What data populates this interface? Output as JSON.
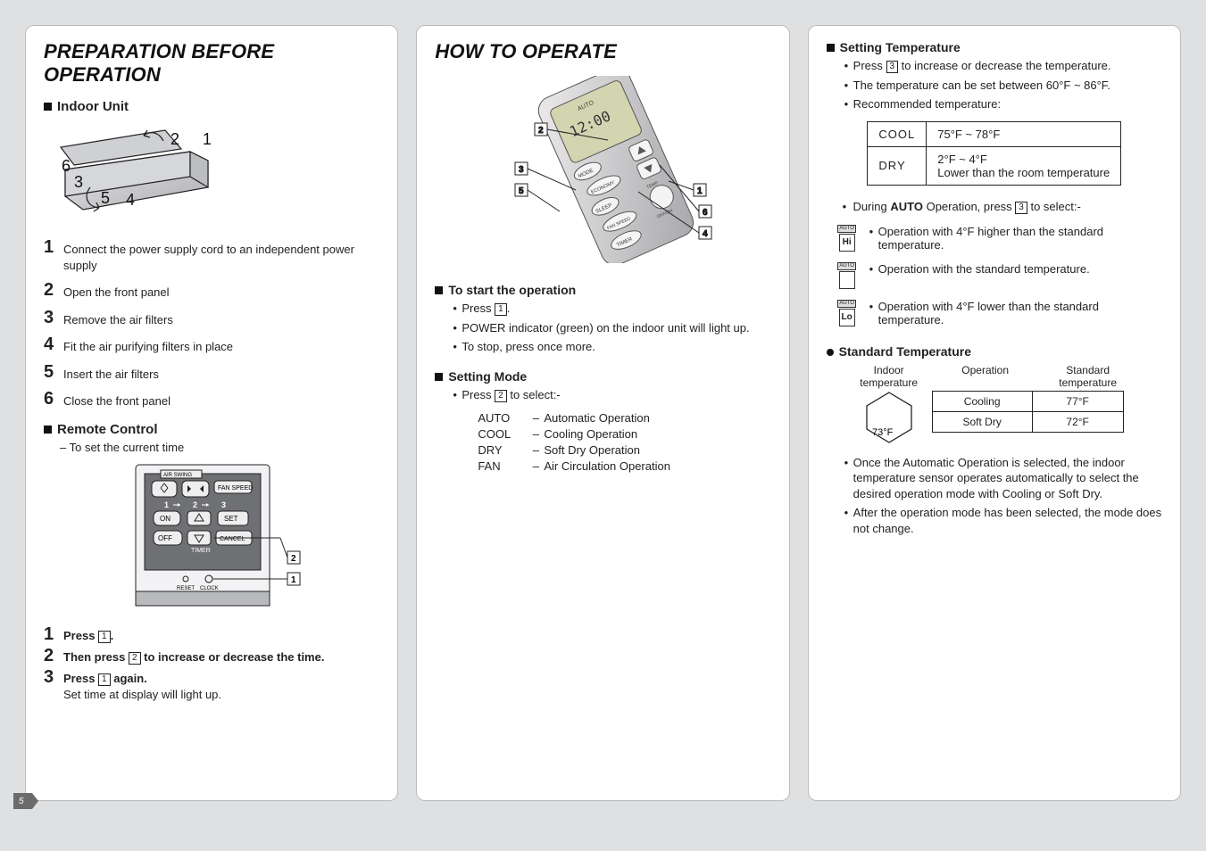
{
  "page_number": "5",
  "col1": {
    "title": "PREPARATION BEFORE OPERATION",
    "indoor_heading": "Indoor Unit",
    "indoor_labels": [
      "1",
      "2",
      "3",
      "4",
      "5",
      "6"
    ],
    "steps": [
      "Connect the power supply cord to an independent power supply",
      "Open the front panel",
      "Remove the air filters",
      "Fit the air purifying filters in place",
      "Insert the air filters",
      "Close the front panel"
    ],
    "remote_heading": "Remote Control",
    "remote_note": "– To set the current time",
    "remote_labels": {
      "air_swing": "AIR SWING",
      "fan_speed": "FAN SPEED",
      "on": "ON",
      "set": "SET",
      "off": "OFF",
      "cancel": "CANCEL",
      "timer": "TIMER",
      "reset": "RESET",
      "clock": "CLOCK",
      "n1": "1",
      "n2": "2",
      "n3": "3",
      "callout1": "1",
      "callout2": "2"
    },
    "remote_steps": {
      "s1": "Press ",
      "s1b": ".",
      "s2a": "Then press ",
      "s2b": " to increase or decrease the time.",
      "s3a": "Press ",
      "s3b": " again.",
      "s3c": "Set time at display will light up."
    }
  },
  "col2": {
    "title": "HOW TO OPERATE",
    "callouts": [
      "1",
      "2",
      "3",
      "4",
      "5",
      "6"
    ],
    "remote_display": "12:00",
    "remote_text": {
      "auto": "AUTO",
      "mode": "MODE",
      "econ": "ECONOMY",
      "sleep": "SLEEP",
      "fan": "FAN SPEED",
      "off_on": "OFF/ON",
      "timer": "TIMER"
    },
    "start_heading": "To start the operation",
    "start_items": [
      "Press ",
      "POWER indicator (green) on the indoor unit will light up.",
      "To stop, press once more."
    ],
    "start_b1_suffix": ".",
    "mode_heading": "Setting Mode",
    "mode_press": "Press ",
    "mode_press_suffix": " to select:-",
    "modes": [
      {
        "k": "AUTO",
        "v": "Automatic Operation"
      },
      {
        "k": "COOL",
        "v": "Cooling Operation"
      },
      {
        "k": "DRY",
        "v": "Soft Dry Operation"
      },
      {
        "k": "FAN",
        "v": "Air Circulation Operation"
      }
    ]
  },
  "col3": {
    "temp_heading": "Setting Temperature",
    "temp_items": [
      "Press  to increase or decrease the temperature.",
      "The temperature can be set between 60°F ~ 86°F.",
      "Recommended temperature:"
    ],
    "temp_press_prefix": "Press ",
    "temp_press_suffix": " to increase or decrease the temperature.",
    "rec_table": [
      {
        "k": "COOL",
        "v": "75°F ~ 78°F"
      },
      {
        "k": "DRY",
        "v": "2°F ~ 4°F\nLower than the room temperature"
      }
    ],
    "auto_line_a": "During ",
    "auto_line_bold": "AUTO",
    "auto_line_b": " Operation, press ",
    "auto_line_c": " to select:-",
    "auto_items": [
      {
        "ic": "Hi",
        "txt": "Operation with 4°F higher than the standard temperature."
      },
      {
        "ic": "",
        "txt": "Operation with the standard temperature."
      },
      {
        "ic": "Lo",
        "txt": "Operation with 4°F lower than the standard temperature."
      }
    ],
    "auto_icon_label": "AUTO",
    "std_heading": "Standard Temperature",
    "std_col1_label": "Indoor temperature",
    "std_col2_label": "Operation",
    "std_col3_label": "Standard temperature",
    "std_threshold": "73°F",
    "std_rows": [
      {
        "op": "Cooling",
        "t": "77°F"
      },
      {
        "op": "Soft Dry",
        "t": "72°F"
      }
    ],
    "tail": [
      "Once the Automatic Operation is selected, the indoor temperature sensor operates automatically to select the desired operation mode with Cooling or Soft Dry.",
      "After the operation mode has been selected, the mode does not change."
    ]
  }
}
